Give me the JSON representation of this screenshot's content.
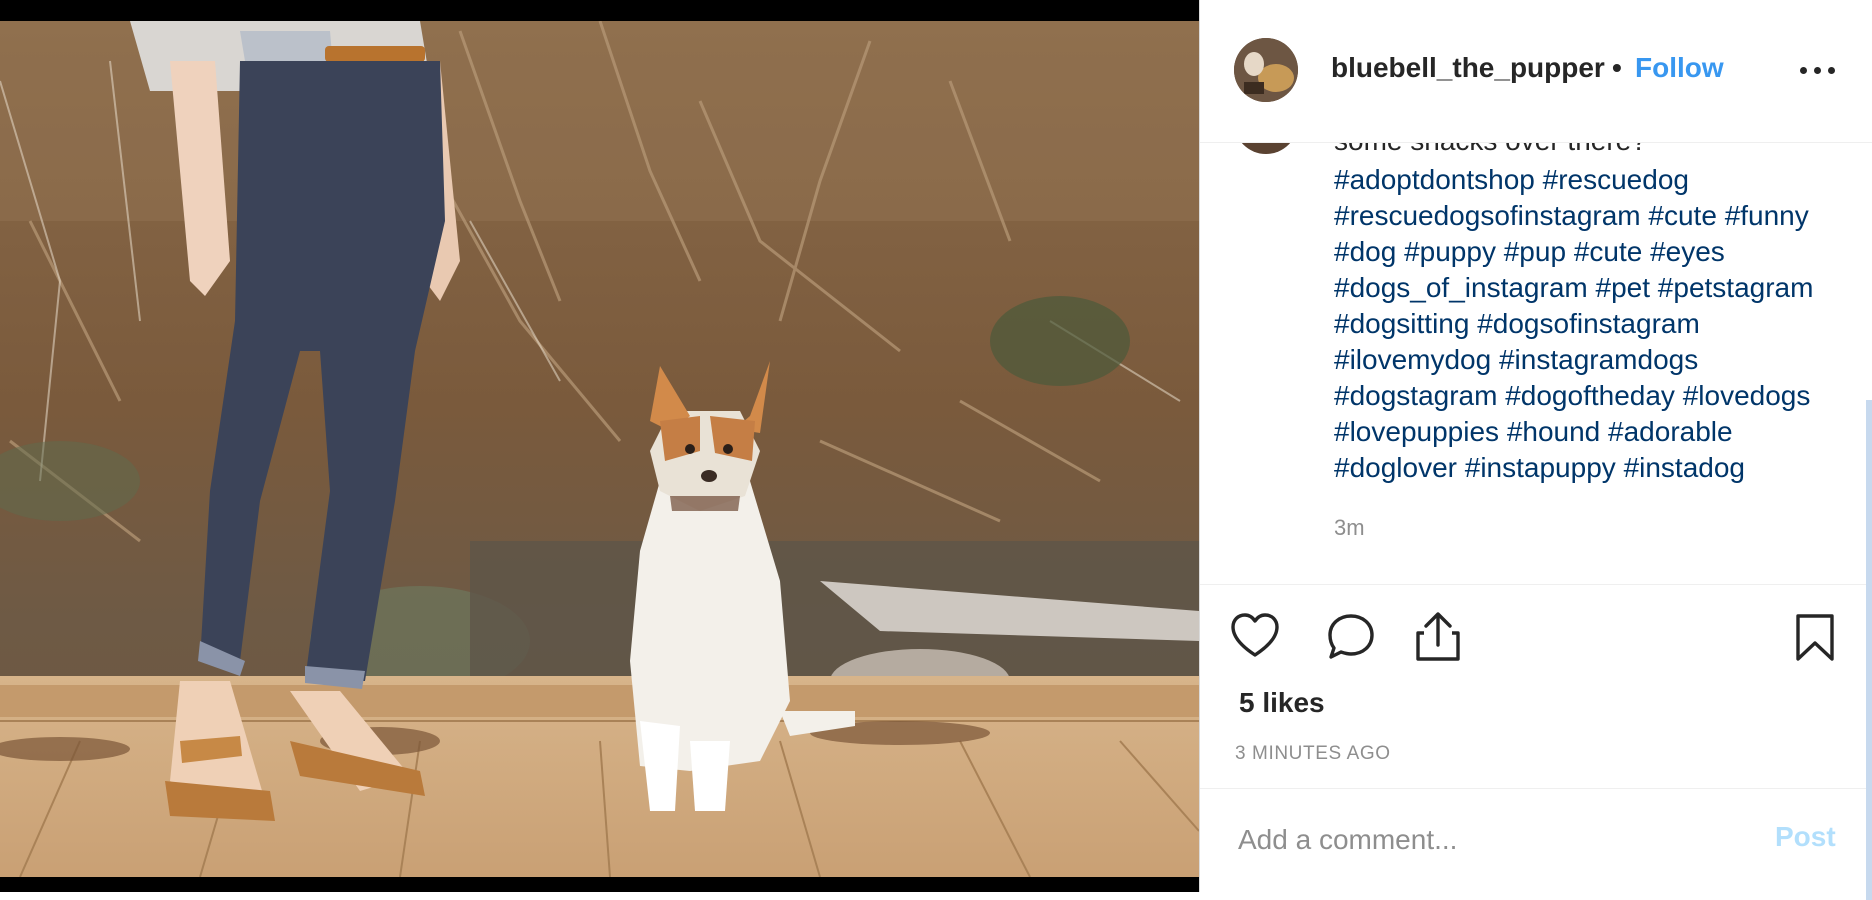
{
  "post": {
    "username": "bluebell_the_pupper",
    "separator": "•",
    "follow_label": "Follow",
    "more_icon": "more-options-icon"
  },
  "caption": {
    "partial_line": "some snacks over there?",
    "hashtag_lines": [
      [
        "#adoptdontshop",
        "#rescuedog"
      ],
      [
        "#rescuedogsofinstagram",
        "#cute",
        "#funny"
      ],
      [
        "#dog",
        "#puppy",
        "#pup",
        "#cute",
        "#eyes"
      ],
      [
        "#dogs_of_instagram",
        "#pet",
        "#petstagram"
      ],
      [
        "#dogsitting",
        "#dogsofinstagram"
      ],
      [
        "#ilovemydog",
        "#instagramdogs"
      ],
      [
        "#dogstagram",
        "#dogoftheday",
        "#lovedogs"
      ],
      [
        "#lovepuppies",
        "#hound",
        "#adorable"
      ],
      [
        "#doglover",
        "#instapuppy",
        "#instadog"
      ]
    ],
    "time_ago": "3m"
  },
  "actions": {
    "like_icon": "heart-icon",
    "comment_icon": "comment-icon",
    "share_icon": "share-icon",
    "save_icon": "bookmark-icon"
  },
  "likes_text": "5 likes",
  "posted_ago": "3 MINUTES AGO",
  "comment": {
    "placeholder": "Add a comment...",
    "value": "",
    "post_label": "Post"
  },
  "colors": {
    "link_blue": "#3897f0",
    "hashtag_blue": "#003569",
    "post_disabled": "#b2dffc",
    "muted": "#8e8e8e"
  }
}
